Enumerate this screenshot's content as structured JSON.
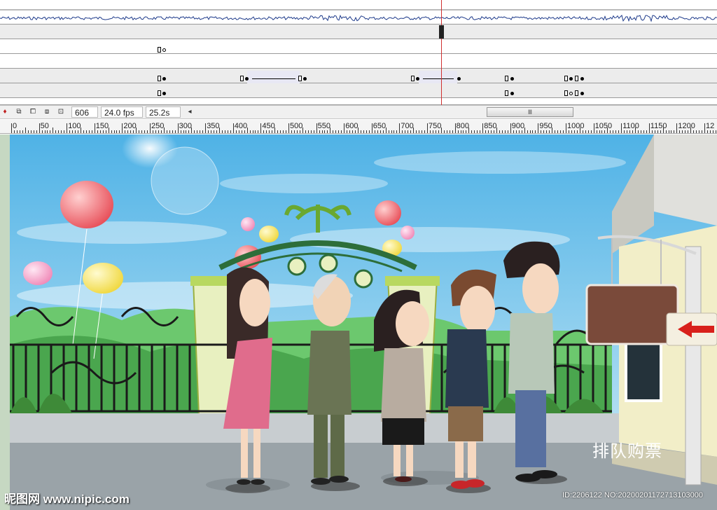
{
  "timeline": {
    "toolbar": {
      "frame": "606",
      "fps": "24.0 fps",
      "time": "25.2s",
      "scroll_left_glyph": "◂",
      "scroll_thumb_glyph": "Ⅲ",
      "icons": [
        "keyframe-marker-icon",
        "onion-skin-icon",
        "onion-outline-icon",
        "edit-multiple-frames-icon",
        "marker-range-icon"
      ]
    }
  },
  "ruler": {
    "labels": [
      "0",
      "50",
      "100",
      "150",
      "200",
      "250",
      "300",
      "350",
      "400",
      "450",
      "500",
      "550",
      "600",
      "650",
      "700",
      "750",
      "800",
      "850",
      "900",
      "950",
      "1000",
      "1050",
      "1100",
      "1150",
      "1200",
      "12"
    ]
  },
  "scene": {
    "sign_text": "排队购票",
    "colors": {
      "sky_top": "#4fb2e6",
      "sky_bottom": "#bfe4f4",
      "grass": "#5cb84a",
      "pavement": "#9aa3a8",
      "sign_board": "#7a4a3a",
      "arrow_red": "#d8211b"
    }
  },
  "watermark": {
    "left": "昵图网 www.nipic.com",
    "right": "ID:2206122 NO:20200201172713103000"
  }
}
